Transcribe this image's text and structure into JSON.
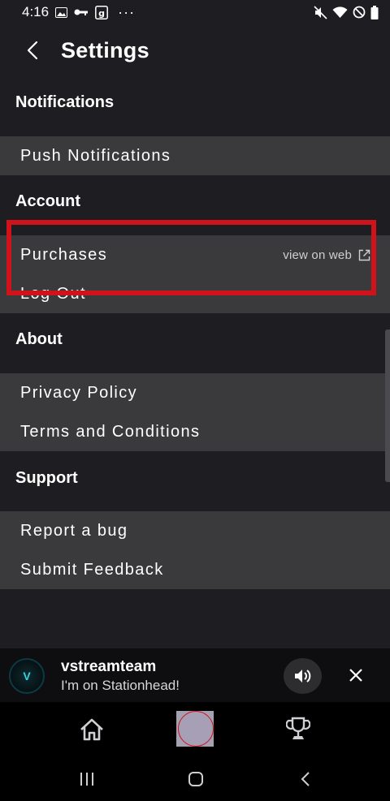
{
  "status_bar": {
    "time": "4:16",
    "more": "···"
  },
  "header": {
    "title": "Settings"
  },
  "sections": {
    "notifications": {
      "title": "Notifications",
      "rows": [
        "Push Notifications"
      ]
    },
    "account": {
      "title": "Account",
      "purchases": "Purchases",
      "view_on_web": "view on web",
      "logout": "Log Out"
    },
    "about": {
      "title": "About",
      "rows": [
        "Privacy Policy",
        "Terms and Conditions"
      ]
    },
    "support": {
      "title": "Support",
      "rows": [
        "Report a bug",
        "Submit Feedback"
      ]
    }
  },
  "now_playing": {
    "name": "vstreamteam",
    "status": "I'm on Stationhead!",
    "avatar_letter": "V"
  },
  "colors": {
    "background": "#1e1e22",
    "group_bg": "#3a3a3c",
    "highlight": "#d0121a",
    "bar_bg": "#0e0e10"
  }
}
